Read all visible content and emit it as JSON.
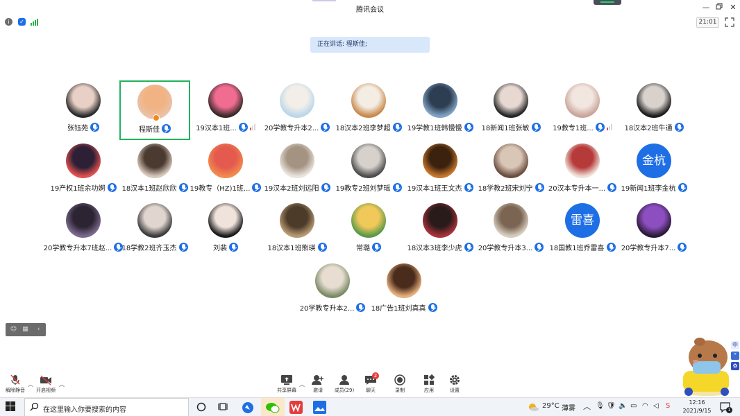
{
  "window": {
    "title": "腾讯会议",
    "time": "21:01"
  },
  "speaking": "正在讲话: 程斯佳;",
  "participants": [
    {
      "name": "张钰苑"
    },
    {
      "name": "程斯佳"
    },
    {
      "name": "19汉本1班..."
    },
    {
      "name": "20学教专升本2..."
    },
    {
      "name": "18汉本2班李梦超"
    },
    {
      "name": "19学教1班韩慢慢"
    },
    {
      "name": "18新闻1班张敏"
    },
    {
      "name": "19教专1班..."
    },
    {
      "name": "18汉本2班牛通"
    },
    {
      "name": "19产权1班余功婀"
    },
    {
      "name": "18汉本1班赵欣欣"
    },
    {
      "name": "19教专（HZ)1班..."
    },
    {
      "name": "19汉本2班刘远阳"
    },
    {
      "name": "19教专2班刘梦瑶"
    },
    {
      "name": "19汉本1班王文杰"
    },
    {
      "name": "18学教2班宋刘宁"
    },
    {
      "name": "20汉本专升本一..."
    },
    {
      "name": "19新闻1班李金杭",
      "avatar_text": "金杭"
    },
    {
      "name": "20学教专升本7班赵..."
    },
    {
      "name": "18学教2班齐玉杰"
    },
    {
      "name": "刘裴"
    },
    {
      "name": "18汉本1班熊瑛"
    },
    {
      "name": "常璐"
    },
    {
      "name": "18汉本3班李少虎"
    },
    {
      "name": "20学教专升本3..."
    },
    {
      "name": "18国教1班乔雷喜",
      "avatar_text": "雷喜"
    },
    {
      "name": "20学教专升本7..."
    },
    {
      "name": "20学教专升本2..."
    },
    {
      "name": "18广告1班刘真真"
    }
  ],
  "toolbar": {
    "unmute": "解除静音",
    "start_video": "开启视频",
    "share_screen": "共享屏幕",
    "invite": "邀请",
    "members": "成员(29)",
    "chat": "聊天",
    "chat_badge": "2",
    "record": "录制",
    "apps": "应用",
    "settings": "设置"
  },
  "taskbar": {
    "search_placeholder": "在这里输入你要搜索的内容",
    "weather_temp": "29°C",
    "weather_desc": "薄雾",
    "clock_time": "12:16",
    "clock_date": "2021/9/15",
    "notification_count": "1"
  },
  "ime": {
    "lang": "中"
  }
}
